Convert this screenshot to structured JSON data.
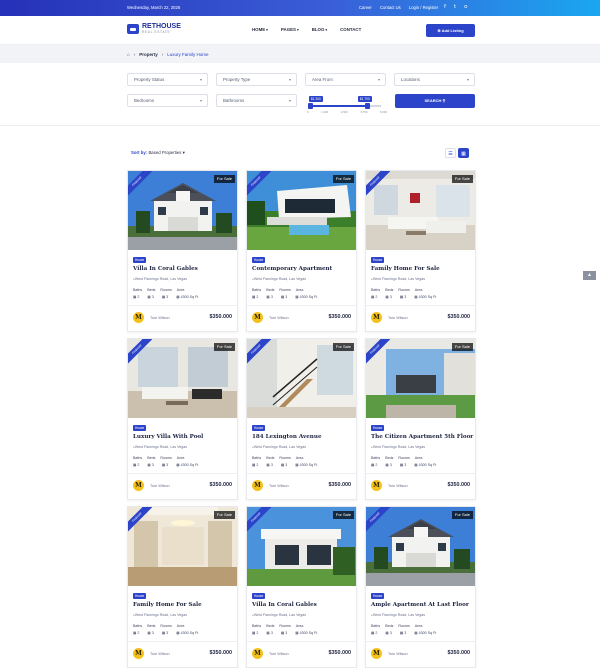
{
  "topbar": {
    "date": "Wednesday, March 22, 2026",
    "links": [
      "Career",
      "Contact Us",
      "Login / Register"
    ],
    "social": [
      "f",
      "t",
      "o"
    ]
  },
  "header": {
    "logo_main": "RETHOUSE",
    "logo_sub": "REAL ESTATE",
    "nav": [
      "HOME",
      "PAGES",
      "BLOG",
      "CONTACT"
    ],
    "add_listing": "Add Listing"
  },
  "breadcrumb": {
    "items": [
      "Property",
      "Luxury Family Home"
    ]
  },
  "filters": {
    "property_status": "Property Status",
    "property_type": "Property Type",
    "area_from": "Area From",
    "locations": "Locations",
    "bedrooms": "Bedrooms",
    "bathrooms": "Bathrooms",
    "range_min": "$1 300",
    "range_max": "$1 700",
    "range_ticks": [
      "0",
      "1,300",
      "2,500",
      "3,750",
      "5,000"
    ],
    "search": "SEARCH"
  },
  "sort": {
    "label": "Sort by:",
    "value": "Based Properties"
  },
  "listing_common": {
    "ribbon": "Featured",
    "status": "For Sale",
    "type": "House",
    "address": "West Flamingo Road, Las Vegas",
    "features": [
      "Baths",
      "Beds",
      "Rooms",
      "Area"
    ],
    "baths": "2",
    "beds": "3",
    "rooms": "3",
    "area": "4300 Sq Ft",
    "agent": "Tom Wilson",
    "agent_initial": "M",
    "price": "$350.000"
  },
  "listings": [
    {
      "title": "Villa In Coral Gables"
    },
    {
      "title": "Contemporary Apartment"
    },
    {
      "title": "Family Home For Sale"
    },
    {
      "title": "Luxury Villa With Pool"
    },
    {
      "title": "184 Lexington Avenue"
    },
    {
      "title": "The Citizen Apartment 5th Floor"
    },
    {
      "title": "Family Home For Sale"
    },
    {
      "title": "Villa In Coral Gables"
    },
    {
      "title": "Ample Apartment At Last Floor"
    }
  ],
  "colors": {
    "primary": "#2b44c9",
    "topbar_start": "#2531b8",
    "topbar_end": "#1aa7f0",
    "agent_badge": "#f2c21b"
  }
}
